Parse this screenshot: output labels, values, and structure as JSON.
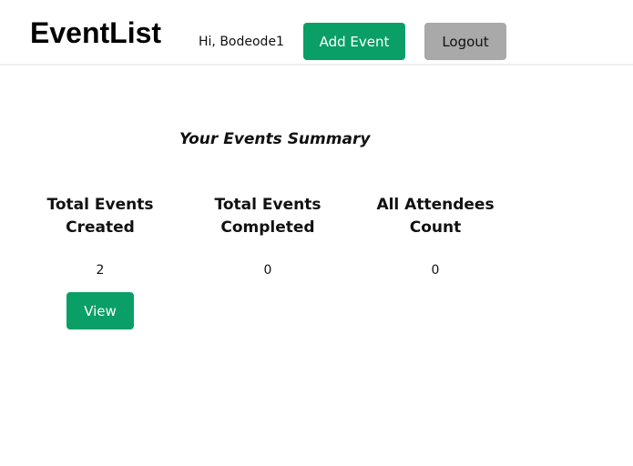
{
  "header": {
    "logo": "EventList",
    "greeting": "Hi, Bodeode1",
    "add_event_label": "Add Event",
    "logout_label": "Logout"
  },
  "summary": {
    "title": "Your Events Summary",
    "stats": [
      {
        "label_line1": "Total Events",
        "label_line2": "Created",
        "value": "2"
      },
      {
        "label_line1": "Total Events",
        "label_line2": "Completed",
        "value": "0"
      },
      {
        "label_line1": "All Attendees",
        "label_line2": "Count",
        "value": "0"
      }
    ],
    "view_label": "View"
  },
  "colors": {
    "primary": "#0a9f67",
    "secondary": "#a9a9a9"
  }
}
